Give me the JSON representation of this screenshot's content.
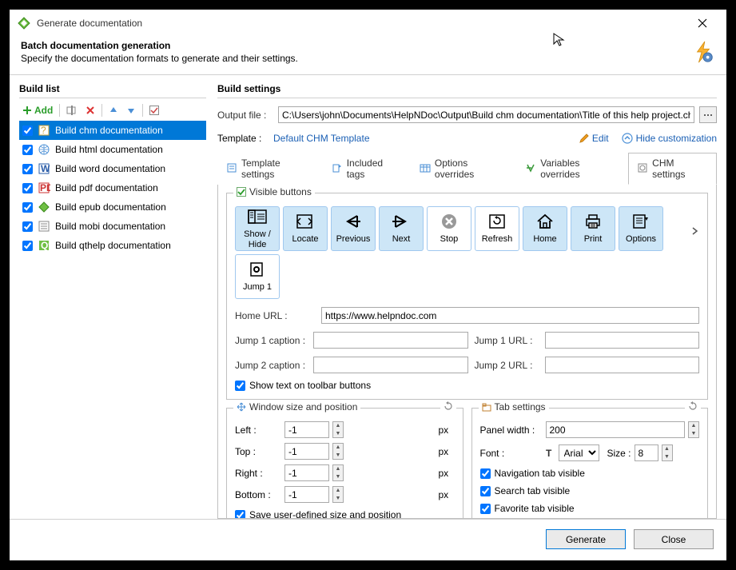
{
  "window": {
    "title": "Generate documentation",
    "heading": "Batch documentation generation",
    "subheading": "Specify the documentation formats to generate and their settings."
  },
  "left": {
    "title": "Build list",
    "add_label": "Add",
    "items": [
      {
        "label": "Build chm documentation",
        "icon": "chm",
        "selected": true
      },
      {
        "label": "Build html documentation",
        "icon": "html",
        "selected": false
      },
      {
        "label": "Build word documentation",
        "icon": "word",
        "selected": false
      },
      {
        "label": "Build pdf documentation",
        "icon": "pdf",
        "selected": false
      },
      {
        "label": "Build epub documentation",
        "icon": "epub",
        "selected": false
      },
      {
        "label": "Build mobi documentation",
        "icon": "mobi",
        "selected": false
      },
      {
        "label": "Build qthelp documentation",
        "icon": "qthelp",
        "selected": false
      }
    ]
  },
  "right": {
    "title": "Build settings",
    "output_label": "Output file :",
    "output_value": "C:\\Users\\john\\Documents\\HelpNDoc\\Output\\Build chm documentation\\Title of this help project.chm",
    "template_label": "Template :",
    "template_link": "Default CHM Template",
    "edit_label": "Edit",
    "hide_label": "Hide customization"
  },
  "tabs": [
    {
      "label": "Template settings"
    },
    {
      "label": "Included tags"
    },
    {
      "label": "Options overrides"
    },
    {
      "label": "Variables overrides"
    },
    {
      "label": "CHM settings"
    }
  ],
  "chm": {
    "visible_buttons_legend": "Visible buttons",
    "buttons": [
      {
        "label": "Show / Hide",
        "selected": true
      },
      {
        "label": "Locate",
        "selected": true
      },
      {
        "label": "Previous",
        "selected": true
      },
      {
        "label": "Next",
        "selected": true
      },
      {
        "label": "Stop",
        "selected": false
      },
      {
        "label": "Refresh",
        "selected": false
      },
      {
        "label": "Home",
        "selected": true
      },
      {
        "label": "Print",
        "selected": true
      },
      {
        "label": "Options",
        "selected": true
      },
      {
        "label": "Jump 1",
        "selected": false
      }
    ],
    "home_url_label": "Home URL :",
    "home_url_value": "https://www.helpndoc.com",
    "jump1_caption_label": "Jump 1 caption :",
    "jump1_caption_value": "",
    "jump1_url_label": "Jump 1 URL :",
    "jump1_url_value": "",
    "jump2_caption_label": "Jump 2 caption :",
    "jump2_caption_value": "",
    "jump2_url_label": "Jump 2 URL :",
    "jump2_url_value": "",
    "show_text_label": "Show text on toolbar buttons",
    "window_legend": "Window size and position",
    "left_label": "Left :",
    "left_value": "-1",
    "top_label": "Top :",
    "top_value": "-1",
    "right_label": "Right :",
    "right_value": "-1",
    "bottom_label": "Bottom :",
    "bottom_value": "-1",
    "px": "px",
    "save_user_label": "Save user-defined size and position",
    "tab_settings_legend": "Tab settings",
    "panel_width_label": "Panel width :",
    "panel_width_value": "200",
    "font_label": "Font :",
    "font_value": "Arial",
    "size_label": "Size :",
    "size_value": "8",
    "nav_tab_label": "Navigation tab visible",
    "search_tab_label": "Search tab visible",
    "fav_tab_label": "Favorite tab visible"
  },
  "footer": {
    "generate": "Generate",
    "close": "Close"
  }
}
